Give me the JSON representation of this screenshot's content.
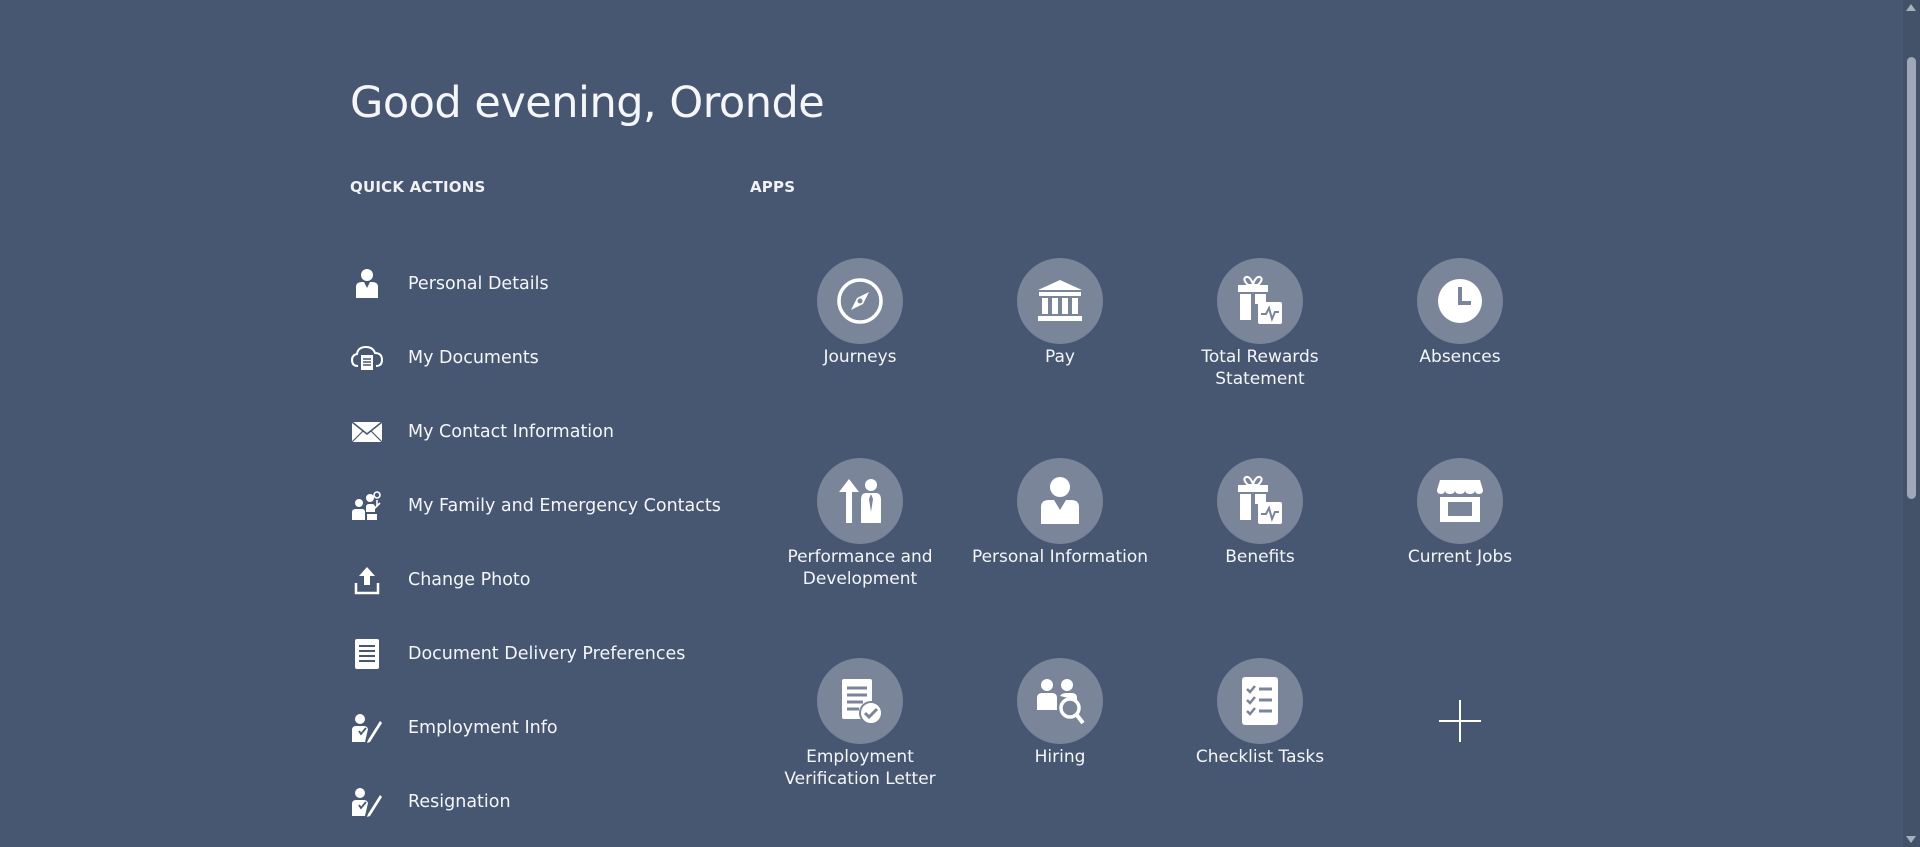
{
  "greeting": "Good evening, Oronde",
  "quick_actions": {
    "title": "QUICK ACTIONS",
    "items": [
      {
        "label": "Personal Details",
        "icon": "person-icon"
      },
      {
        "label": "My Documents",
        "icon": "cloud-document-icon"
      },
      {
        "label": "My Contact Information",
        "icon": "envelope-icon"
      },
      {
        "label": "My Family and Emergency Contacts",
        "icon": "family-icon"
      },
      {
        "label": "Change Photo",
        "icon": "upload-icon"
      },
      {
        "label": "Document Delivery Preferences",
        "icon": "document-icon"
      },
      {
        "label": "Employment Info",
        "icon": "person-edit-icon"
      },
      {
        "label": "Resignation",
        "icon": "person-edit-icon"
      }
    ]
  },
  "apps": {
    "title": "APPS",
    "tiles": [
      {
        "label": "Journeys",
        "icon": "compass-icon"
      },
      {
        "label": "Pay",
        "icon": "bank-icon"
      },
      {
        "label": "Total Rewards Statement",
        "icon": "gift-chart-icon"
      },
      {
        "label": "Absences",
        "icon": "clock-icon"
      },
      {
        "label": "Performance and Development",
        "icon": "growth-person-icon"
      },
      {
        "label": "Personal Information",
        "icon": "person-icon"
      },
      {
        "label": "Benefits",
        "icon": "gift-chart-icon"
      },
      {
        "label": "Current Jobs",
        "icon": "store-icon"
      },
      {
        "label": "Employment Verification Letter",
        "icon": "document-check-icon"
      },
      {
        "label": "Hiring",
        "icon": "people-search-icon"
      },
      {
        "label": "Checklist Tasks",
        "icon": "checklist-icon"
      }
    ],
    "add_icon": "plus-icon"
  },
  "colors": {
    "background": "#475671",
    "tile_circle": "#7a8599",
    "text": "#f4f6f9"
  }
}
